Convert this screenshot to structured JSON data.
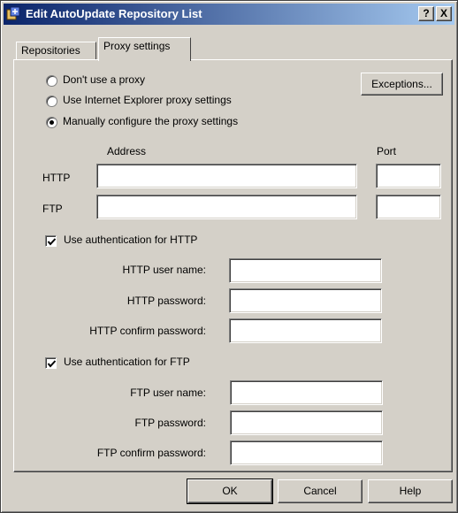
{
  "window": {
    "title": "Edit AutoUpdate Repository List",
    "help_glyph": "?",
    "close_glyph": "X"
  },
  "tabs": [
    {
      "label": "Repositories",
      "selected": false
    },
    {
      "label": "Proxy settings",
      "selected": true
    }
  ],
  "proxy": {
    "options": [
      {
        "label": "Don't use a proxy",
        "selected": false
      },
      {
        "label": "Use Internet Explorer proxy settings",
        "selected": false
      },
      {
        "label": "Manually configure the proxy settings",
        "selected": true
      }
    ],
    "exceptions_label": "Exceptions...",
    "address_header": "Address",
    "port_header": "Port",
    "http_label": "HTTP",
    "ftp_label": "FTP",
    "http_address": "",
    "http_port": "",
    "ftp_address": "",
    "ftp_port": ""
  },
  "http_auth": {
    "checkbox_label": "Use authentication for HTTP",
    "checked": true,
    "user_label": "HTTP user name:",
    "password_label": "HTTP password:",
    "confirm_label": "HTTP confirm password:",
    "user": "",
    "password": "",
    "confirm": ""
  },
  "ftp_auth": {
    "checkbox_label": "Use authentication for FTP",
    "checked": true,
    "user_label": "FTP user name:",
    "password_label": "FTP password:",
    "confirm_label": "FTP confirm password:",
    "user": "",
    "password": "",
    "confirm": ""
  },
  "buttons": {
    "ok": "OK",
    "cancel": "Cancel",
    "help": "Help"
  },
  "colors": {
    "face": "#d4d0c8",
    "title_start": "#0a246a",
    "title_end": "#a6caf0"
  }
}
